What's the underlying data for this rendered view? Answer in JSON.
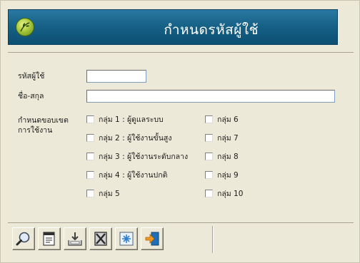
{
  "header": {
    "title": "กำหนดรหัสผู้ใช้",
    "logo_icon": "leaf-logo-icon"
  },
  "form": {
    "username_label": "รหัสผู้ใช้",
    "username_value": "",
    "fullname_label": "ชื่อ-สกุล",
    "fullname_value": "",
    "scope_label_line1": "กำหนดขอบเขต",
    "scope_label_line2": "การใช้งาน",
    "groups": [
      {
        "label": "กลุ่ม 1 : ผู้ดูแลระบบ",
        "checked": false
      },
      {
        "label": "กลุ่ม 2 : ผู้ใช้งานขั้นสูง",
        "checked": false
      },
      {
        "label": "กลุ่ม 3 : ผู้ใช้งานระดับกลาง",
        "checked": false
      },
      {
        "label": "กลุ่ม 4 : ผู้ใช้งานปกติ",
        "checked": false
      },
      {
        "label": "กลุ่ม 5",
        "checked": false
      },
      {
        "label": "กลุ่ม 6",
        "checked": false
      },
      {
        "label": "กลุ่ม 7",
        "checked": false
      },
      {
        "label": "กลุ่ม 8",
        "checked": false
      },
      {
        "label": "กลุ่ม 9",
        "checked": false
      },
      {
        "label": "กลุ่ม 10",
        "checked": false
      }
    ]
  },
  "toolbar": {
    "buttons": [
      {
        "icon": "search-icon"
      },
      {
        "icon": "edit-icon"
      },
      {
        "icon": "save-icon"
      },
      {
        "icon": "delete-icon"
      },
      {
        "icon": "clear-icon"
      },
      {
        "icon": "exit-icon"
      }
    ]
  },
  "colors": {
    "header": "#176287",
    "window": "#ece9d8",
    "field_border": "#7f9db9"
  }
}
